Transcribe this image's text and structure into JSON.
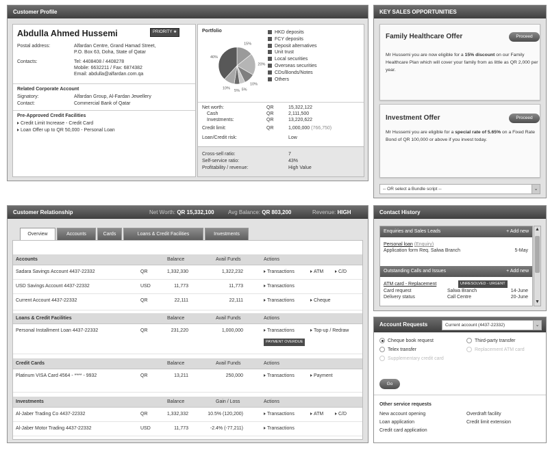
{
  "profile": {
    "title": "Customer Profile",
    "name": "Abdulla Ahmed Hussemi",
    "priority": "PRIORITY ★",
    "postal_label": "Postal address:",
    "postal_line1": "Alfardan Centre, Grand Hamad Street,",
    "postal_line2": "P.O. Box 63, Doha, State of Qatar",
    "contacts_label": "Contacts:",
    "tel": "Tel: 4408408  /  4408278",
    "mobile": "Mobile: 6632211  /  Fax: 6874382",
    "email": "Email: abdulla@alfardan.com.qa",
    "related_title": "Related Corporate Account",
    "signatory_label": "Signatory:",
    "signatory": "Alfardan Group, Al-Fardan Jewellery",
    "contact_label": "Contact:",
    "contact": "Commercial Bank of Qatar",
    "preapproved_title": "Pre-Approved Credit Facilities",
    "pre1": "Credit Limit Increase - Credit Card",
    "pre2": "Loan Offer up to QR 50,000 - Personal Loan"
  },
  "portfolio": {
    "title": "Portfolio",
    "slice_labels": [
      "15%",
      "20%",
      "10%",
      "5%",
      "5%",
      "10%",
      "40%"
    ],
    "legend": [
      "HKD deposits",
      "FCY deposits",
      "Deposit alternatives",
      "Unit trust",
      "Local securities",
      "Overseas securities",
      "CDs/Bonds/Notes",
      "Others"
    ],
    "networth_label": "Net worth:",
    "cash_label": "Cash",
    "invest_label": "Investments:",
    "credit_label": "Credit limit:",
    "risk_label": "Loan/Credit risk:",
    "cur": "QR",
    "networth": "15,322,122",
    "cash": "2,111,500",
    "invest": "13,220,622",
    "credit": "1,000,000",
    "credit_extra": "(766,750)",
    "risk": "Low",
    "cross_label": "Cross-sell ratio:",
    "cross": "7",
    "self_label": "Self-service ratio:",
    "self": "43%",
    "profit_label": "Profitability / revenue:",
    "profit": "High Value"
  },
  "sales": {
    "title": "KEY SALES OPPORTUNITIES",
    "o1_title": "Family Healthcare Offer",
    "o1_btn": "Proceed",
    "o1_a": "Mr Hussemi you are now eligible for a ",
    "o1_b": "15% discount",
    "o1_c": "on our Family Healthcare Plan which will cover your family from as little as QR 2,000 per year.",
    "o2_title": "Investment Offer",
    "o2_btn": "Proceed",
    "o2_a": "Mr Hussemi you are eligible for a ",
    "o2_b": "special rate of 5.65%",
    "o2_c": " on a Fixed Rate Bond of QR 100,000 or above if you invest today.",
    "bundle": "-- OR select a Bundle script --"
  },
  "rel": {
    "title": "Customer Relationship",
    "nw_label": "Net Worth:",
    "nw": "QR 15,332,100",
    "avg_label": "Avg Balance:",
    "avg": "QR 803,200",
    "rev_label": "Revenue:",
    "rev": "HIGH",
    "tabs": [
      "Overview",
      "Accounts",
      "Cards",
      "Loans & Credit Facilities",
      "Investments"
    ],
    "h_balance": "Balance",
    "h_avail": "Avail Funds",
    "h_actions": "Actions",
    "h_gain": "Gain / Loss",
    "accounts_title": "Accounts",
    "loans_title": "Loans & Credit Facilities",
    "cards_title": "Credit Cards",
    "inv_title": "Investments",
    "acc": [
      [
        "Sadara Savings Account  4437-22332",
        "QR",
        "1,332,330",
        "1,322,232"
      ],
      [
        "USD Savings Account  4437-22332",
        "USD",
        "11,773",
        "11,773"
      ],
      [
        "Current Account  4437-22332",
        "QR",
        "22,111",
        "22,111"
      ]
    ],
    "loan": [
      "Personal Installment Loan  4437-22332",
      "QR",
      "231,220",
      "1,000,000"
    ],
    "card": [
      "Platinum VISA Card  4564 - **** - 9932",
      "QR",
      "13,211",
      "250,000"
    ],
    "inv": [
      [
        "Al-Jaber Trading Co  4437-22332",
        "QR",
        "1,332,332",
        "10.5% (120,200)"
      ],
      [
        "Al-Jaber Motor Trading  4437-22332",
        "USD",
        "11,773",
        "-2.4% (-77,211)"
      ]
    ],
    "a_trans": "Transactions",
    "a_atm": "ATM",
    "a_cd": "C/D",
    "a_cheque": "Cheque",
    "a_topup": "Top-up / Redraw",
    "a_payment": "Payment",
    "overdue": "PAYMENT OVERDUE"
  },
  "history": {
    "title": "Contact History",
    "enq_title": "Enquiries and Sales Leads",
    "add_new": "+ Add new",
    "enq_link": "Personal loan",
    "enq_link2": "(Enquiry)",
    "enq_desc": "Application form Req. Salwa Branch",
    "enq_date": "5-May",
    "out_title": "Outstanding Calls and Issues",
    "out_link": "ATM card - Replacement",
    "out_badge": "UNRESOLVED - URGENT",
    "out_r1a": "Card request",
    "out_r1b": "Salwa Branch",
    "out_r1c": "14-June",
    "out_r2a": "Delivery status",
    "out_r2b": "Call Centre",
    "out_r2c": "20-June"
  },
  "requests": {
    "title": "Account Requests",
    "account": "Current account (4437-22332)",
    "opt1": "Cheque book request",
    "opt2": "Third-party transfer",
    "opt3": "Telex transfer",
    "opt4": "Replacement ATM card",
    "opt5": "Supplementary credit card",
    "go": "Go",
    "other_title": "Other service requests",
    "s1": "New account opening",
    "s2": "Overdraft facility",
    "s3": "Loan application",
    "s4": "Credit limit extension",
    "s5": "Credit card application"
  }
}
